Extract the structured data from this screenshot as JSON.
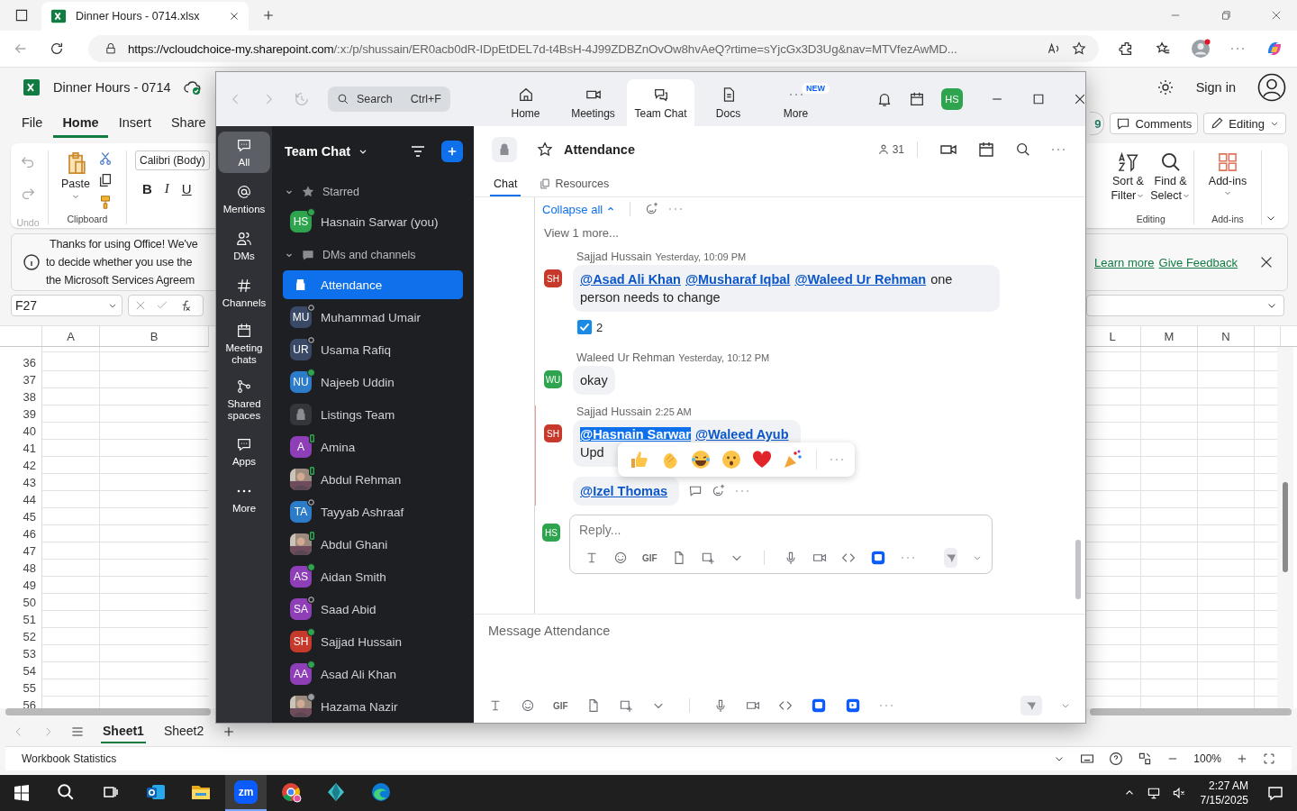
{
  "browser": {
    "tab_title": "Dinner Hours - 0714.xlsx",
    "url_host": "https://vcloudchoice-my.sharepoint.com",
    "url_path": "/:x:/p/shussain/ER0acb0dR-IDpEtDEL7d-t4BsH-4J99ZDBZnOvOw8hvAeQ?rtime=sYjcGx3D3Ug&nav=MTVfezAwMD..."
  },
  "excel": {
    "title": "Dinner Hours - 0714",
    "sign_in": "Sign in",
    "menu_tabs": [
      {
        "label": "File",
        "selected": false
      },
      {
        "label": "Home",
        "selected": true
      },
      {
        "label": "Insert",
        "selected": false
      },
      {
        "label": "Share",
        "selected": false
      }
    ],
    "coauthors": "9",
    "comments": "Comments",
    "editing": "Editing",
    "ribbon": {
      "undo_group": "Undo",
      "paste": "Paste",
      "clipboard_group": "Clipboard",
      "font": "Calibri (Body)",
      "bold": "B",
      "italic": "I",
      "underline": "U",
      "sort": [
        "Sort &",
        "Filter"
      ],
      "find": [
        "Find &",
        "Select"
      ],
      "editing_group": "Editing",
      "addins": "Add-ins",
      "addins_group": "Add-ins"
    },
    "notice": {
      "lines": [
        "Thanks for using Office! We've",
        "to decide whether you use the",
        "the Microsoft Services Agreem"
      ],
      "links": [
        "Learn more",
        "Give Feedback"
      ]
    },
    "name_box": "F27",
    "columns_left": [
      "A",
      "B"
    ],
    "columns_right": [
      "L",
      "M",
      "N"
    ],
    "rows": [
      "36",
      "37",
      "38",
      "39",
      "40",
      "41",
      "42",
      "43",
      "44",
      "45",
      "46",
      "47",
      "48",
      "49",
      "50",
      "51",
      "52",
      "53",
      "54",
      "55",
      "56"
    ],
    "sheets": [
      {
        "label": "Sheet1",
        "selected": true
      },
      {
        "label": "Sheet2",
        "selected": false
      }
    ],
    "status": "Workbook Statistics",
    "zoom": "100%"
  },
  "taskbar": {
    "apps": [
      {
        "kind": "search",
        "selected": false
      },
      {
        "kind": "taskview",
        "selected": false
      },
      {
        "kind": "outlook",
        "selected": false
      },
      {
        "kind": "folder",
        "selected": false
      },
      {
        "kind": "zoom",
        "selected": true
      },
      {
        "kind": "chrome",
        "selected": false
      },
      {
        "kind": "gem",
        "selected": false
      },
      {
        "kind": "edge",
        "selected": false
      }
    ],
    "zoom_label": "zm",
    "time": "2:27 AM",
    "date": "7/15/2025"
  },
  "zoom": {
    "search": "Search",
    "shortcut": "Ctrl+F",
    "nav_tabs": [
      {
        "label": "Home",
        "selected": false
      },
      {
        "label": "Meetings",
        "selected": false
      },
      {
        "label": "Team Chat",
        "selected": true
      },
      {
        "label": "Docs",
        "selected": false
      },
      {
        "label": "More",
        "selected": false,
        "badge": "NEW"
      }
    ],
    "user_initials": "HS",
    "rail": [
      {
        "label": "All",
        "selected": true
      },
      {
        "label": "Mentions",
        "selected": false
      },
      {
        "label": "DMs",
        "selected": false
      },
      {
        "label": "Channels",
        "selected": false
      },
      {
        "label": "Meeting chats",
        "selected": false
      },
      {
        "label": "Shared spaces",
        "selected": false
      },
      {
        "label": "Apps",
        "selected": false
      },
      {
        "label": "More",
        "selected": false
      }
    ],
    "list_title": "Team Chat",
    "sections": [
      {
        "title": "Starred",
        "expanded": true,
        "items": [
          {
            "name": "Hasnain Sarwar (you)",
            "kind": "initials",
            "initials": "HS",
            "color": "#2ea44f",
            "presence": {
              "kind": "online"
            },
            "selected": false
          }
        ]
      },
      {
        "title": "DMs and channels",
        "expanded": true,
        "items": [
          {
            "name": "Attendance",
            "kind": "lock",
            "selected": true
          },
          {
            "name": "Muhammad Umair",
            "kind": "initials",
            "initials": "MU",
            "color": "#3a4a66",
            "presence": {
              "kind": "offline"
            },
            "selected": false
          },
          {
            "name": "Usama Rafiq",
            "kind": "initials",
            "initials": "UR",
            "color": "#3a4a66",
            "presence": {
              "kind": "offline"
            },
            "selected": false
          },
          {
            "name": "Najeeb Uddin",
            "kind": "initials",
            "initials": "NU",
            "color": "#2c7cc9",
            "presence": {
              "kind": "online"
            },
            "selected": false
          },
          {
            "name": "Listings Team",
            "kind": "lock",
            "selected": false
          },
          {
            "name": "Amina",
            "kind": "initials",
            "initials": "A",
            "color": "#8e3fb8",
            "presence": {
              "kind": "mobile"
            },
            "selected": false
          },
          {
            "name": "Abdul Rehman",
            "kind": "picture",
            "presence": {
              "kind": "mobile"
            },
            "selected": false
          },
          {
            "name": "Tayyab Ashraaf",
            "kind": "initials",
            "initials": "TA",
            "color": "#2c7cc9",
            "presence": {
              "kind": "offline"
            },
            "selected": false
          },
          {
            "name": "Abdul Ghani",
            "kind": "picture",
            "presence": {
              "kind": "mobile"
            },
            "selected": false
          },
          {
            "name": "Aidan Smith",
            "kind": "initials",
            "initials": "AS",
            "color": "#8e3fb8",
            "presence": {
              "kind": "online"
            },
            "selected": false
          },
          {
            "name": "Saad Abid",
            "kind": "initials",
            "initials": "SA",
            "color": "#8e3fb8",
            "presence": {
              "kind": "offline"
            },
            "selected": false
          },
          {
            "name": "Sajjad Hussain",
            "kind": "initials",
            "initials": "SH",
            "color": "#c7392b",
            "presence": {
              "kind": "online"
            },
            "selected": false
          },
          {
            "name": "Asad Ali Khan",
            "kind": "initials",
            "initials": "AA",
            "color": "#8e3fb8",
            "presence": {
              "kind": "online"
            },
            "selected": false
          },
          {
            "name": "Hazama Nazir",
            "kind": "picture",
            "presence": {
              "kind": "away"
            },
            "selected": false
          }
        ]
      }
    ],
    "channel": {
      "title": "Attendance",
      "members": "31",
      "tabs": [
        {
          "label": "Chat",
          "selected": true
        },
        {
          "label": "Resources",
          "selected": false
        }
      ]
    },
    "thread": {
      "collapse": "Collapse all",
      "view_more": "View 1 more...",
      "messages": [
        {
          "sender": "Sajjad Hussain",
          "time": "Yesterday, 10:09 PM",
          "initials": "SH",
          "color": "#c7392b",
          "unread": false,
          "picker_open": false,
          "lines": [
            [
              {
                "kind": "mention",
                "text": "@Asad Ali Khan",
                "highlighted": false
              },
              {
                "kind": "mention",
                "text": "@Musharaf Iqbal",
                "highlighted": false
              },
              {
                "kind": "mention",
                "text": "@Waleed Ur Rehman",
                "highlighted": false
              },
              {
                "kind": "text",
                "text": "one person needs to change"
              }
            ]
          ],
          "reaction_count": "2"
        },
        {
          "sender": "Waleed Ur Rehman",
          "time": "Yesterday, 10:12 PM",
          "initials": "WU",
          "color": "#2ea44f",
          "unread": false,
          "picker_open": false,
          "lines": [
            [
              {
                "kind": "text",
                "text": "okay"
              }
            ]
          ]
        },
        {
          "sender": "Sajjad Hussain",
          "time": "2:25 AM",
          "initials": "SH",
          "color": "#c7392b",
          "unread": true,
          "picker_open": true,
          "lines": [
            [
              {
                "kind": "mention",
                "text": "@Hasnain Sarwar",
                "highlighted": true
              },
              {
                "kind": "mention",
                "text": "@Waleed Ayub",
                "highlighted": false
              }
            ],
            [
              {
                "kind": "text",
                "text": "Upd"
              }
            ]
          ],
          "follow_up": [
            {
              "kind": "mention",
              "text": "@Izel Thomas",
              "highlighted": false
            }
          ]
        }
      ],
      "reply_initials": "HS",
      "reply_placeholder": "Reply...",
      "gif": "GIF"
    },
    "composer": {
      "placeholder": "Message Attendance",
      "gif": "GIF"
    }
  }
}
